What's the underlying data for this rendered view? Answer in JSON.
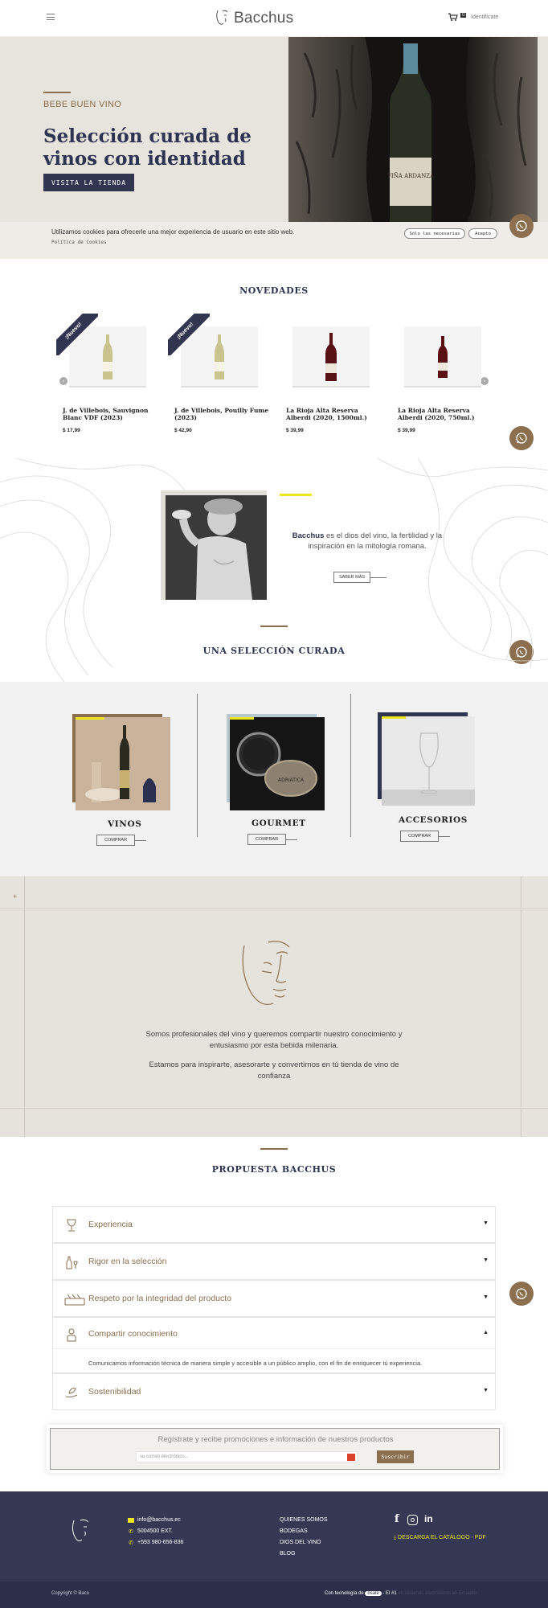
{
  "header": {
    "brand": "Bacchus",
    "cart_count": "0",
    "login_label": "Identifícate"
  },
  "hero": {
    "kicker": "BEBE BUEN VINO",
    "title": "Selección curada de vinos con identidad",
    "button": "VISITA LA TIENDA",
    "bottle_label": "VIÑA ARDANZA"
  },
  "cookies": {
    "message": "Utilizamos cookies para ofrecerle una mejor experiencia de usuario en este sitio web.",
    "policy_link": "Política de Cookies",
    "only_necessary": "Sólo las necesarias",
    "accept": "Acepto"
  },
  "novedades": {
    "title": "NOVEDADES",
    "badge": "¡Nuevo!",
    "products": [
      {
        "name": "J. de Villebois, Sauvignon Blanc VDF (2023)",
        "price": "$ 17,99",
        "is_new": true,
        "wine": "white"
      },
      {
        "name": "J. de Villebois, Pouilly Fume (2023)",
        "price": "$ 42,90",
        "is_new": true,
        "wine": "white"
      },
      {
        "name": "La Rioja Alta Reserva Alberdi (2020, 1500ml.)",
        "price": "$ 39,99",
        "is_new": false,
        "wine": "red"
      },
      {
        "name": "La Rioja Alta Reserva Alberdi (2020, 750ml.)",
        "price": "$ 39,99",
        "is_new": false,
        "wine": "red"
      }
    ]
  },
  "bacchus": {
    "name": "Bacchus",
    "text": " es el dios del vino, la fertilidad y la inspiración en la mitología romana.",
    "more": "SABER MÁS"
  },
  "seleccion": {
    "title": "UNA SELECCIÓN CURADA",
    "categories": [
      {
        "title": "VINOS",
        "button": "COMPRAR"
      },
      {
        "title": "GOURMET",
        "button": "COMPRAR",
        "product_label": "ADRIATICA"
      },
      {
        "title": "ACCESORIOS",
        "button": "COMPRAR"
      }
    ]
  },
  "about": {
    "text1": "Somos profesionales del vino y queremos compartir nuestro conocimiento y entusiasmo por esta bebida milenaria.",
    "text2": "Estamos para inspirarte, asesorarte y convertirnos en tú tienda de vino de confianza"
  },
  "propuesta": {
    "title": "PROPUESTA BACCHUS",
    "items": [
      {
        "label": "Experiencia",
        "icon": "wine-glass-icon",
        "open": false
      },
      {
        "label": "Rigor en la selección",
        "icon": "bottle-glass-icon",
        "open": false
      },
      {
        "label": "Respeto por la integridad del producto",
        "icon": "wine-rack-icon",
        "open": false
      },
      {
        "label": "Compartir conocimiento",
        "icon": "sommelier-icon",
        "open": true,
        "body": "Comunicamos información técnica de manera simple y accesible a un público amplio, con el fin de enriquecer tú experiencia."
      },
      {
        "label": "Sostenibilidad",
        "icon": "leaf-hand-icon",
        "open": false
      }
    ]
  },
  "newsletter": {
    "title": "Regístrate y recibe promociones e información de nuestros productos",
    "placeholder": "su correo electrónico...",
    "button": "Suscribir"
  },
  "footer": {
    "email": "info@bacchus.ec",
    "phone1": "5004500 EXT.",
    "phone2": "+593 980-656-836",
    "links": [
      "QUIENES SOMOS",
      "BODEGAS",
      "DIOS DEL VINO",
      "BLOG"
    ],
    "catalog": "DESCARGA EL CATÁLOGO - PDF",
    "copyright": "Copyright © Baco",
    "powered": "Con tecnología de",
    "powered_brand": "bsale",
    "powered_rank": "- El #1",
    "powered_tail": "en sistemas electrónicos en Ecuador"
  },
  "colors": {
    "navy": "#323550",
    "brown": "#8b6f4e",
    "beige": "#e7e3dd",
    "yellow": "#ece81c",
    "footer": "#363752"
  }
}
